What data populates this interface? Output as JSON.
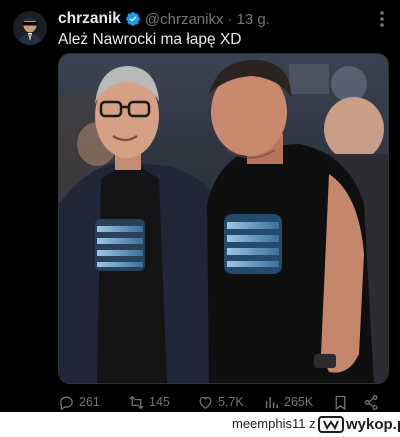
{
  "tweet": {
    "display_name": "chrzanik",
    "handle": "@chrzanikx",
    "separator": "·",
    "time": "13 g.",
    "text": "Ależ Nawrocki ma łapę XD",
    "verified_color": "#1d9bf0"
  },
  "actions": {
    "replies": "261",
    "retweets": "145",
    "likes": "5,7K",
    "views": "265K"
  },
  "footer": {
    "username": "meemphis11",
    "preposition": "z",
    "site": "wykop.pl"
  },
  "colors": {
    "background": "#000000",
    "text": "#e7e9ea",
    "muted": "#71767b"
  }
}
